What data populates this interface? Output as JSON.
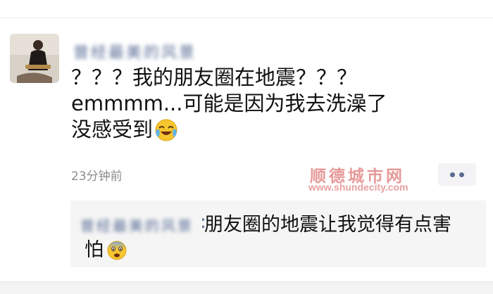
{
  "post": {
    "author_name_redacted": "曾经最美的风景",
    "text": "？？？我的朋友圈在地震？？？\nemmmm...可能是因为我去洗澡了\n没感受到",
    "text_emoji": "face-with-tears-of-joy-icon",
    "timestamp": "23分钟前"
  },
  "watermark": {
    "site_name": "顺德城市网",
    "url": "www.shundecity.com"
  },
  "comment": {
    "author_name_redacted": "曾经最美的风景",
    "separator": ":",
    "text_line1": "朋友圈的地震让我觉得有点害",
    "text_line2": "怕",
    "emoji": "fearful-face-icon"
  },
  "colors": {
    "nickname": "#576b95",
    "watermark": "#d44444",
    "comment_bg": "#f5f5f5"
  }
}
